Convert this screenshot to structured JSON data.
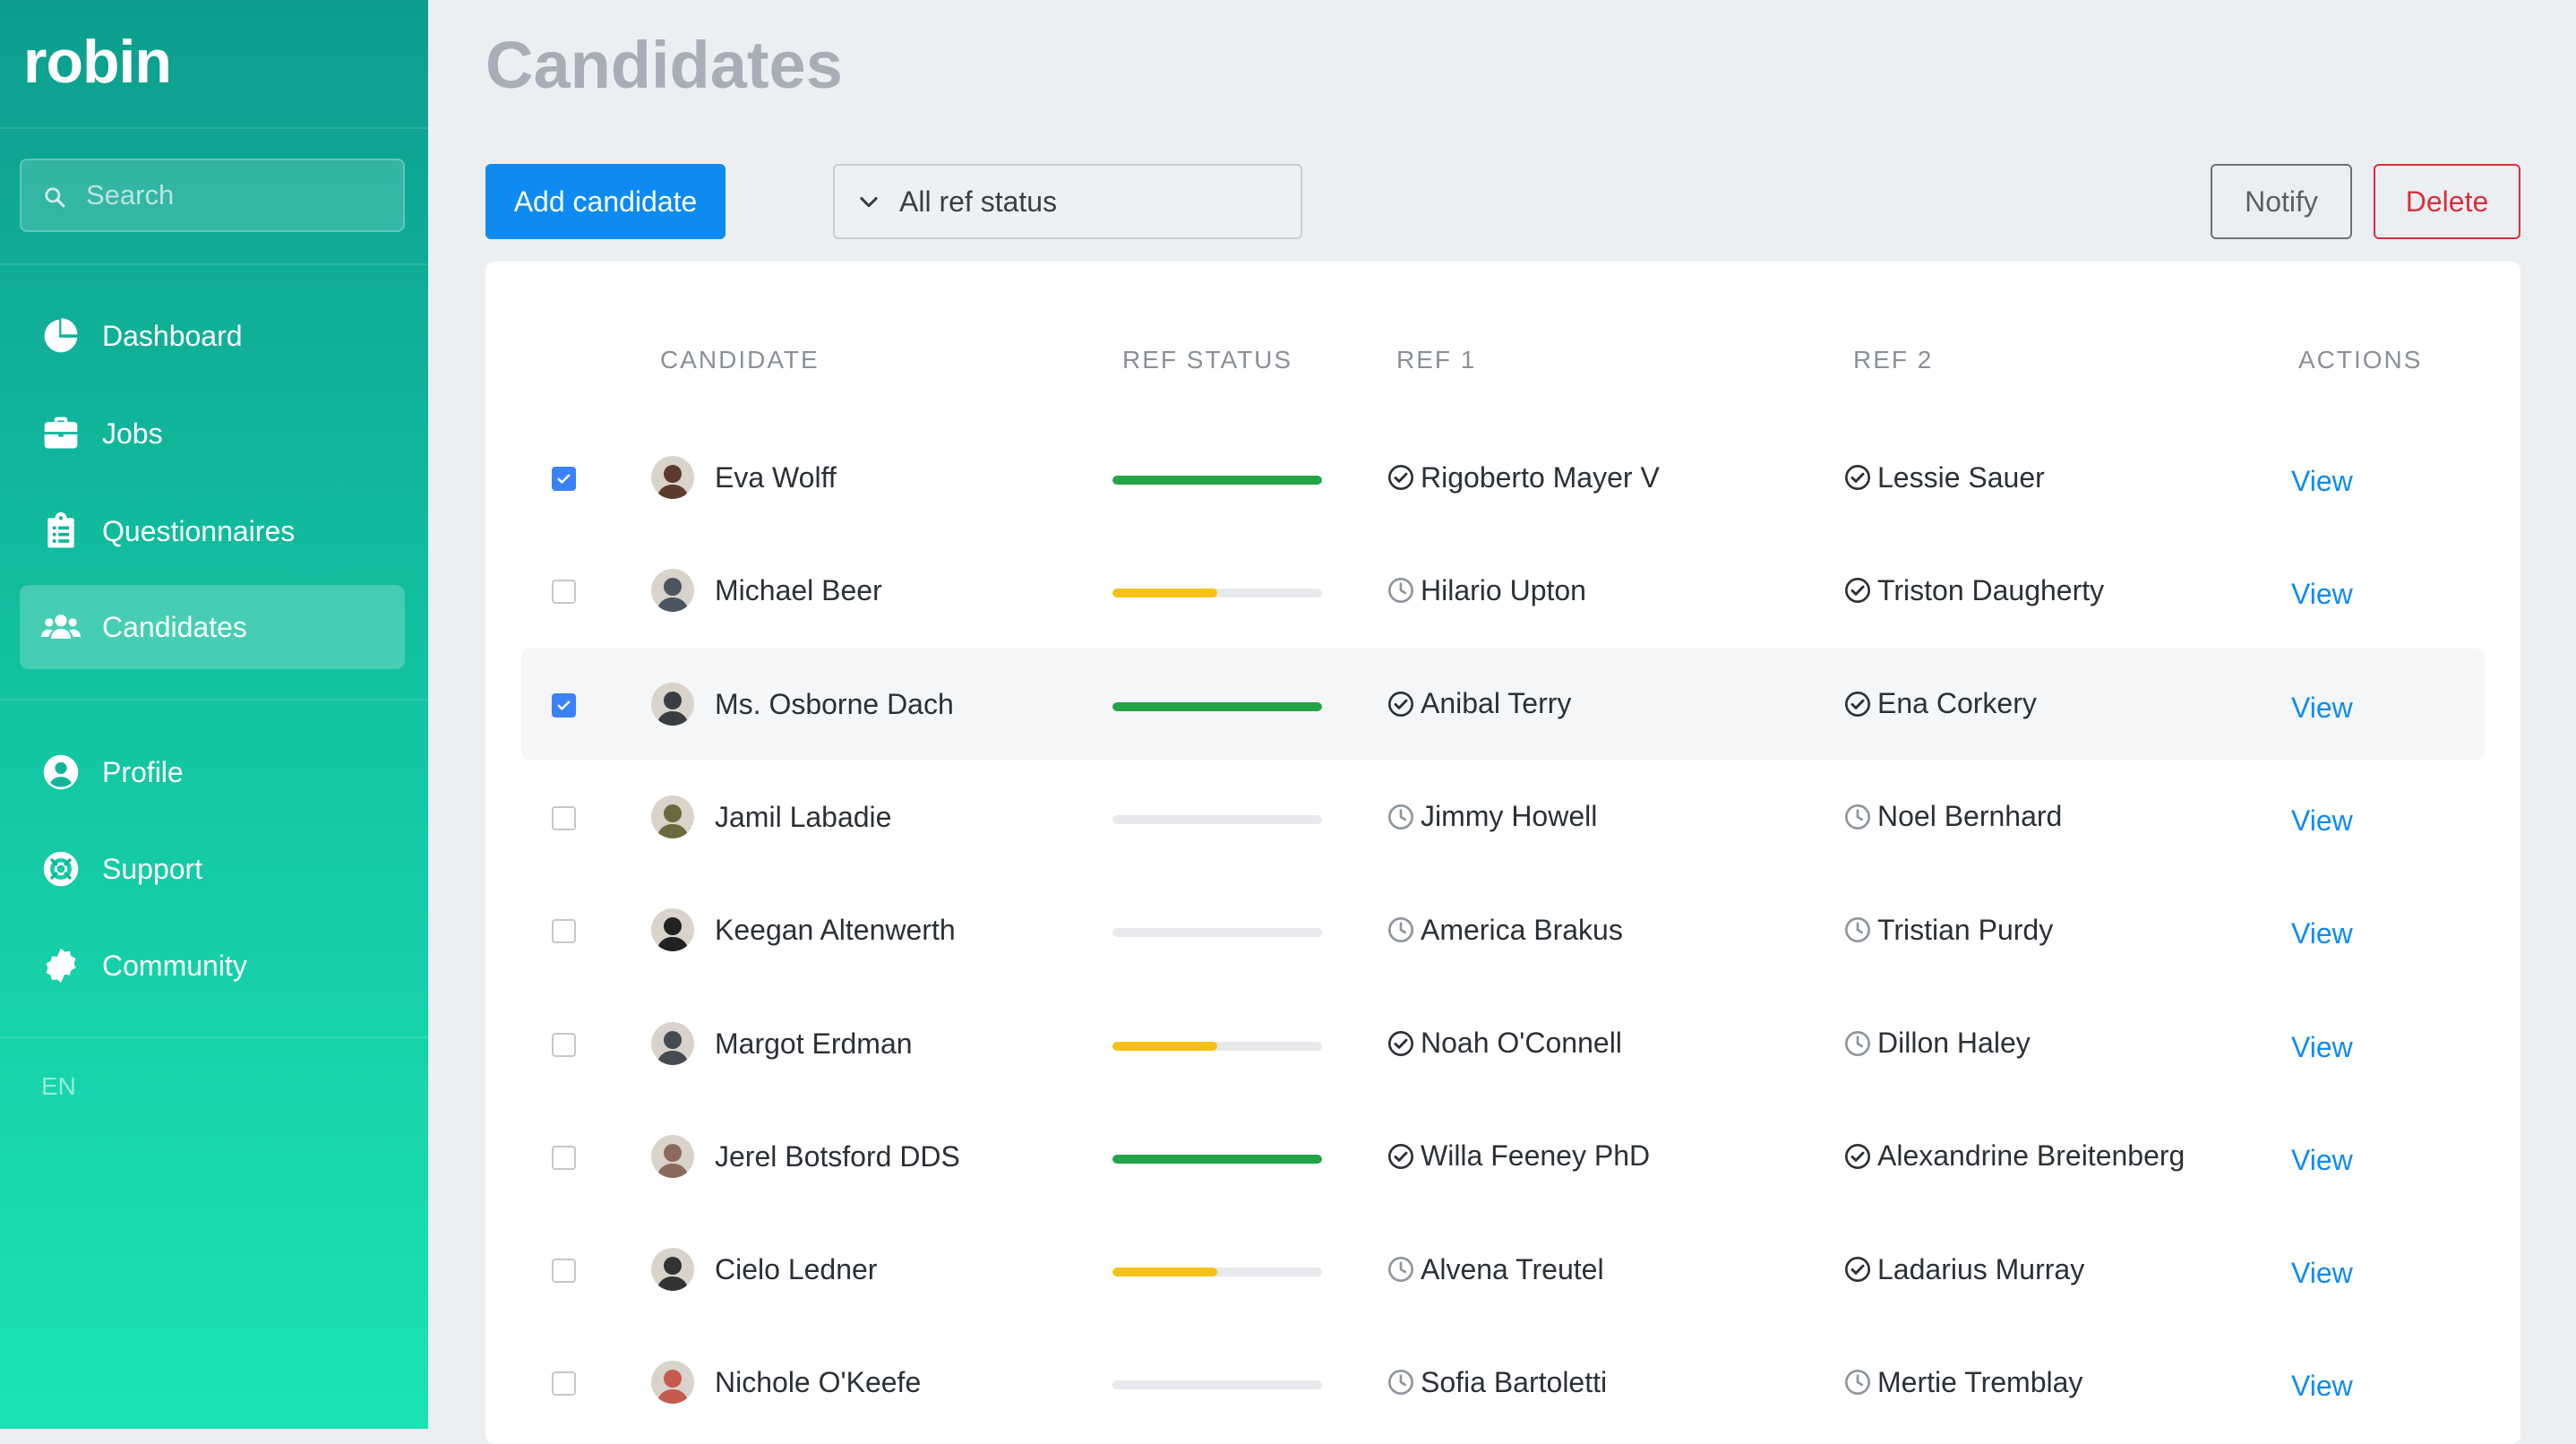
{
  "app": {
    "brand": "robin"
  },
  "sidebar": {
    "search_placeholder": "Search",
    "nav_primary": [
      {
        "label": "Dashboard",
        "icon": "chart-pie-icon"
      },
      {
        "label": "Jobs",
        "icon": "briefcase-icon"
      },
      {
        "label": "Questionnaires",
        "icon": "clipboard-icon"
      },
      {
        "label": "Candidates",
        "icon": "users-icon",
        "active": true
      }
    ],
    "nav_secondary": [
      {
        "label": "Profile",
        "icon": "user-circle-icon"
      },
      {
        "label": "Support",
        "icon": "life-ring-icon"
      },
      {
        "label": "Community",
        "icon": "certificate-icon"
      }
    ],
    "language": "EN"
  },
  "page": {
    "title": "Candidates",
    "add_button": "Add candidate",
    "filter_label": "All ref status",
    "notify_button": "Notify",
    "delete_button": "Delete"
  },
  "colors": {
    "accent": "#0d8bf2",
    "sidebar_top": "#0d9e8e",
    "sidebar_bottom": "#1be3b4",
    "status_complete": "#22a447",
    "status_partial": "#f5c116",
    "delete": "#d7303d"
  },
  "table": {
    "columns": [
      "CANDIDATE",
      "REF STATUS",
      "REF 1",
      "REF 2",
      "ACTIONS"
    ],
    "rows": [
      {
        "name": "Eva Wolff",
        "checked": true,
        "highlighted": false,
        "ref_status": 1.0,
        "ref1": "Rigoberto Mayer V",
        "ref1_state": "done",
        "ref2": "Lessie Sauer",
        "ref2_state": "done",
        "action": "View"
      },
      {
        "name": "Michael Beer",
        "checked": false,
        "highlighted": false,
        "ref_status": 0.5,
        "ref1": "Hilario Upton",
        "ref1_state": "pending",
        "ref2": "Triston Daugherty",
        "ref2_state": "done",
        "action": "View"
      },
      {
        "name": "Ms. Osborne Dach",
        "checked": true,
        "highlighted": true,
        "ref_status": 1.0,
        "ref1": "Anibal Terry",
        "ref1_state": "done",
        "ref2": "Ena Corkery",
        "ref2_state": "done",
        "action": "View"
      },
      {
        "name": "Jamil Labadie",
        "checked": false,
        "highlighted": false,
        "ref_status": 0,
        "ref1": "Jimmy Howell",
        "ref1_state": "pending",
        "ref2": "Noel Bernhard",
        "ref2_state": "pending",
        "action": "View"
      },
      {
        "name": "Keegan Altenwerth",
        "checked": false,
        "highlighted": false,
        "ref_status": 0,
        "ref1": "America Brakus",
        "ref1_state": "pending",
        "ref2": "Tristian Purdy",
        "ref2_state": "pending",
        "action": "View"
      },
      {
        "name": "Margot Erdman",
        "checked": false,
        "highlighted": false,
        "ref_status": 0.5,
        "ref1": "Noah O'Connell",
        "ref1_state": "done",
        "ref2": "Dillon Haley",
        "ref2_state": "pending",
        "action": "View"
      },
      {
        "name": "Jerel Botsford DDS",
        "checked": false,
        "highlighted": false,
        "ref_status": 1.0,
        "ref1": "Willa Feeney PhD",
        "ref1_state": "done",
        "ref2": "Alexandrine Breitenberg",
        "ref2_state": "done",
        "action": "View"
      },
      {
        "name": "Cielo Ledner",
        "checked": false,
        "highlighted": false,
        "ref_status": 0.5,
        "ref1": "Alvena Treutel",
        "ref1_state": "pending",
        "ref2": "Ladarius Murray",
        "ref2_state": "done",
        "action": "View"
      },
      {
        "name": "Nichole O'Keefe",
        "checked": false,
        "highlighted": false,
        "ref_status": 0,
        "ref1": "Sofia Bartoletti",
        "ref1_state": "pending",
        "ref2": "Mertie Tremblay",
        "ref2_state": "pending",
        "action": "View"
      }
    ]
  }
}
